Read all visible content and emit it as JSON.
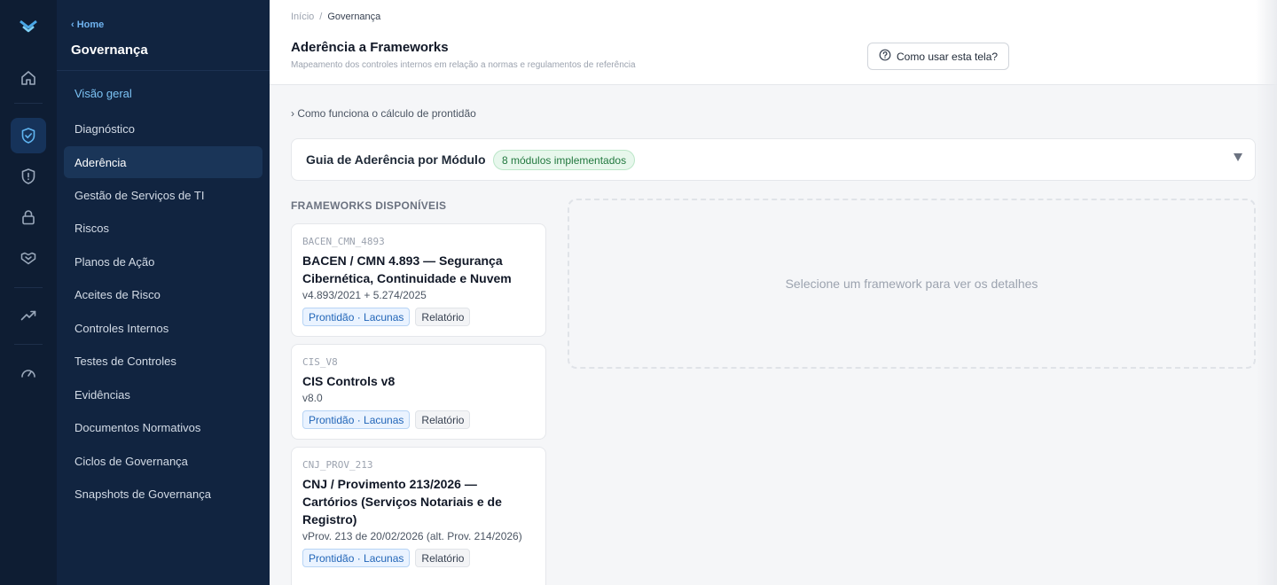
{
  "rail": {
    "icons": [
      "logo-icon",
      "home-icon",
      "shield-check-icon",
      "shield-alert-icon",
      "lock-icon",
      "handshake-icon",
      "trending-up-icon",
      "gauge-icon"
    ],
    "active": "shield-check-icon"
  },
  "sidebar": {
    "back_link": "‹ Home",
    "title": "Governança",
    "items": [
      {
        "label": "Visão geral"
      },
      {
        "label": "Diagnóstico"
      },
      {
        "label": "Aderência"
      },
      {
        "label": "Gestão de Serviços de TI"
      },
      {
        "label": "Riscos"
      },
      {
        "label": "Planos de Ação"
      },
      {
        "label": "Aceites de Risco"
      },
      {
        "label": "Controles Internos"
      },
      {
        "label": "Testes de Controles"
      },
      {
        "label": "Evidências"
      },
      {
        "label": "Documentos Normativos"
      },
      {
        "label": "Ciclos de Governança"
      },
      {
        "label": "Snapshots de Governança"
      }
    ]
  },
  "breadcrumb": {
    "home": "Início",
    "sep": "/",
    "current": "Governança"
  },
  "header": {
    "title": "Aderência a Frameworks",
    "subtitle": "Mapeamento dos controles internos em relação a normas e regulamentos de referência",
    "help_button": "Como usar esta tela?"
  },
  "calc_link": "› Como funciona o cálculo de prontidão",
  "guide": {
    "title": "Guia de Aderência por Módulo",
    "badge": "8 módulos implementados"
  },
  "frameworks_heading": "FRAMEWORKS DISPONÍVEIS",
  "frameworks": [
    {
      "code": "BACEN_CMN_4893",
      "name": "BACEN / CMN 4.893 — Segurança Cibernética, Continuidade e Nuvem",
      "version": "v4.893/2021 + 5.274/2025",
      "tag_primary": "Prontidão · Lacunas",
      "tag_secondary": "Relatório"
    },
    {
      "code": "CIS_V8",
      "name": "CIS Controls v8",
      "version": "v8.0",
      "tag_primary": "Prontidão · Lacunas",
      "tag_secondary": "Relatório"
    },
    {
      "code": "CNJ_PROV_213",
      "name": "CNJ / Provimento 213/2026 — Cartórios (Serviços Notariais e de Registro)",
      "version": "vProv. 213 de 20/02/2026 (alt. Prov. 214/2026)",
      "tag_primary": "Prontidão · Lacunas",
      "tag_secondary": "Relatório"
    }
  ],
  "detail_placeholder": "Selecione um framework para ver os detalhes",
  "colors": {
    "rail_bg": "#0e1d33",
    "sidebar_bg": "#112440",
    "accent": "#7cc3f5",
    "badge_green": "#22783f"
  }
}
